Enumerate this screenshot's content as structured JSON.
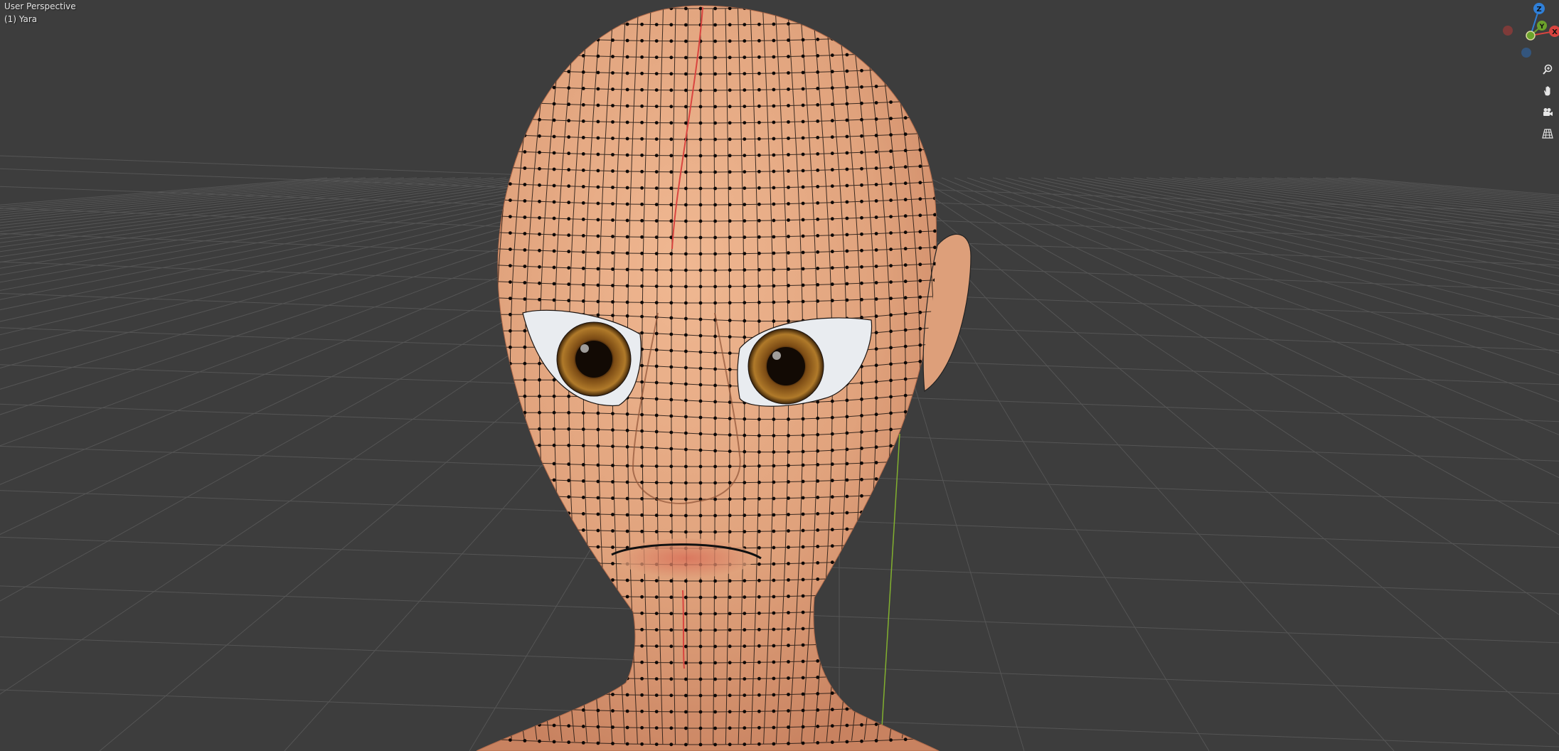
{
  "viewport": {
    "view_name": "User Perspective",
    "object_name": "(1) Yara",
    "background_color": "#3d3d3d",
    "grid_color": "#555555",
    "x_axis_color": "#d9443f",
    "y_axis_color": "#82b02f",
    "skin_color": "#e0a27c"
  },
  "gizmo": {
    "z_label": "Z",
    "y_label": "Y",
    "x_label": "X",
    "z_color": "#2f7fd8",
    "y_color": "#6ba22b",
    "x_color": "#d9443f"
  },
  "nav_buttons": [
    {
      "icon": "zoom-icon"
    },
    {
      "icon": "hand-pan-icon"
    },
    {
      "icon": "camera-icon"
    },
    {
      "icon": "orthographic-grid-icon"
    }
  ]
}
